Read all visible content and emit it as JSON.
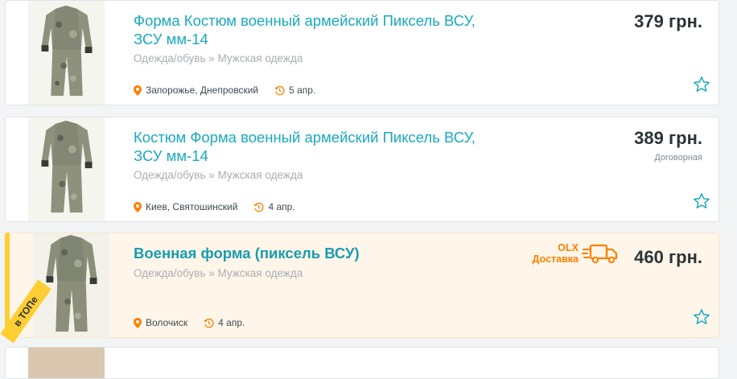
{
  "listings": [
    {
      "title": "Форма Костюм военный армейский Пиксель ВСУ, ЗСУ мм-14",
      "category": "Одежда/обувь » Мужская одежда",
      "location": "Запорожье, Днепровский",
      "date": "5 апр.",
      "price": "379 грн."
    },
    {
      "title": "Костюм Форма военный армейский Пиксель ВСУ, ЗСУ мм-14",
      "category": "Одежда/обувь » Мужская одежда",
      "location": "Киев, Святошинский",
      "date": "4 апр.",
      "price": "389 грн.",
      "negotiable": "Договорная"
    },
    {
      "title": "Военная форма (пиксель ВСУ)",
      "category": "Одежда/обувь » Мужская одежда",
      "location": "Волочиск",
      "date": "4 апр.",
      "price": "460 грн.",
      "top_badge": "в ТОПе",
      "delivery_line1": "OLX",
      "delivery_line2": "Доставка"
    }
  ],
  "colors": {
    "title": "#1ba9bf",
    "price": "#2c3439",
    "accent_orange": "#ff7f00",
    "top_ribbon": "#ffce32",
    "top_background": "#fff6e9"
  },
  "icons": {
    "location": "map-pin-icon",
    "date": "clock-icon",
    "favorite": "star-outline-icon",
    "delivery": "delivery-truck-icon"
  }
}
